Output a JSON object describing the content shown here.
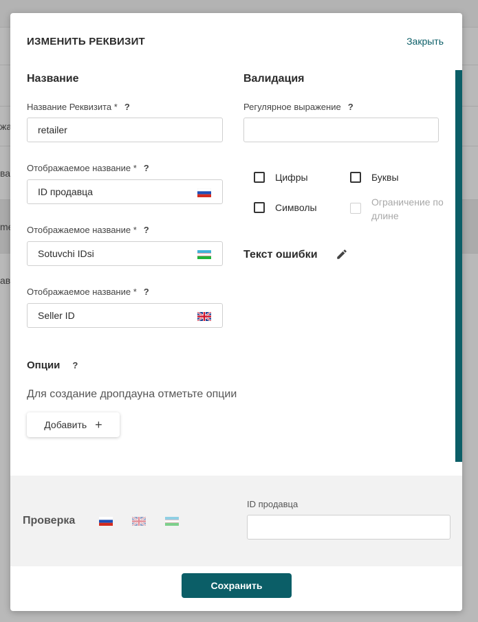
{
  "modal": {
    "title": "ИЗМЕНИТЬ РЕКВИЗИТ",
    "close_label": "Закрыть"
  },
  "name_section": {
    "title": "Название",
    "requisite_name_label": "Название Реквизита *",
    "requisite_name_value": "retailer",
    "display_names": [
      {
        "label": "Отображаемое название *",
        "value": "ID продавца",
        "flag": "ru-flag-icon"
      },
      {
        "label": "Отображаемое название *",
        "value": "Sotuvchi IDsi",
        "flag": "uz-flag-icon"
      },
      {
        "label": "Отображаемое название *",
        "value": "Seller ID",
        "flag": "uk-flag-icon"
      }
    ],
    "help": "?"
  },
  "validation_section": {
    "title": "Валидация",
    "regex_label": "Регулярное выражение",
    "regex_value": "",
    "checkboxes": [
      {
        "label": "Цифры",
        "checked": false,
        "disabled": false
      },
      {
        "label": "Буквы",
        "checked": false,
        "disabled": false
      },
      {
        "label": "Символы",
        "checked": false,
        "disabled": false
      },
      {
        "label": "Ограничение по длине",
        "checked": false,
        "disabled": true
      }
    ],
    "error_text_title": "Текст ошибки"
  },
  "options_section": {
    "title": "Опции",
    "hint": "Для создание дропдауна отметьте опции",
    "add_label": "Добавить",
    "add_icon": "+"
  },
  "check_panel": {
    "title": "Проверка",
    "flags": [
      "ru-flag-icon",
      "uk-flag-icon",
      "uz-flag-icon"
    ],
    "field_label": "ID продавца",
    "field_value": ""
  },
  "footer": {
    "save_label": "Сохранить"
  },
  "background": {
    "fragments": [
      "жа",
      "ва",
      "me",
      "ав"
    ]
  },
  "colors": {
    "accent": "#0b5e67",
    "panel": "#f2f2f2"
  }
}
